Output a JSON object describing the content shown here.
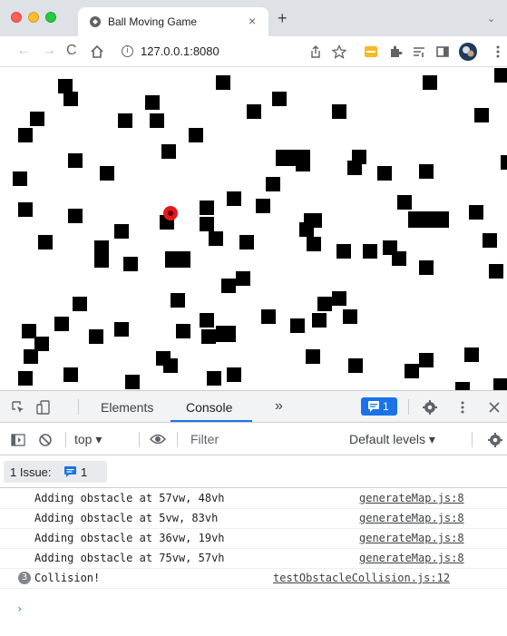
{
  "browser": {
    "tab_title": "Ball Moving Game",
    "tab_close": "×",
    "new_tab": "+",
    "tab_list": "⌄",
    "url": "127.0.0.1:8080",
    "nav_back": "←",
    "nav_forward": "→",
    "nav_reload": "C",
    "toolbar_icons": [
      "share-icon",
      "star-icon",
      "extension-icon",
      "puzzle-icon",
      "reading-list-icon",
      "sidebar-icon",
      "profile-avatar",
      "more-icon"
    ]
  },
  "devtools": {
    "tabs": [
      "Elements",
      "Console"
    ],
    "more_tabs": "»",
    "active_tab": "Console",
    "issues_count": "1",
    "context": "top ▾",
    "filter_placeholder": "Filter",
    "levels": "Default levels ▾",
    "issues_label": "1 Issue:",
    "issues_badge_count": "1",
    "messages": [
      {
        "text": "Adding obstacle at 57vw, 48vh",
        "source": "generateMap.js:8"
      },
      {
        "text": "Adding obstacle at 5vw, 83vh",
        "source": "generateMap.js:8"
      },
      {
        "text": "Adding obstacle at 36vw, 19vh",
        "source": "generateMap.js:8"
      },
      {
        "text": "Adding obstacle at 75vw, 57vh",
        "source": "generateMap.js:8"
      },
      {
        "text": "Collision!",
        "source": "testObstacleCollision.js:12",
        "repeat_count": "3"
      }
    ],
    "prompt": "›"
  },
  "game": {
    "ball_color": "#e8161b",
    "obstacle_color": "#000000"
  }
}
